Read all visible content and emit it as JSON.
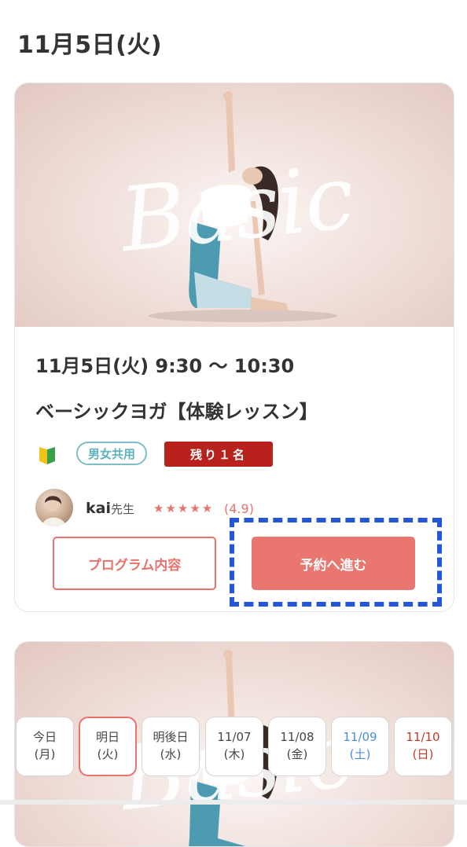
{
  "header": {
    "date": "11月5日(火)"
  },
  "lesson": {
    "hero_text": "Basic",
    "time": "11月5日(火) 9:30 〜 10:30",
    "title": "ベーシックヨガ【体験レッスン】",
    "gender_badge": "男女共用",
    "remaining": "残り１名",
    "teacher_name": "kai",
    "teacher_suffix": "先生",
    "stars": "★★★★★",
    "rating": "(4.9)",
    "rating_value": 4.9,
    "program_button": "プログラム内容",
    "reserve_button": "予約へ進む"
  },
  "second_card": {
    "hero_text": "Basic"
  },
  "day_tabs": [
    {
      "line1": "今日",
      "line2": "(月)"
    },
    {
      "line1": "明日",
      "line2": "(火)"
    },
    {
      "line1": "明後日",
      "line2": "(水)"
    },
    {
      "line1": "11/07",
      "line2": "(木)"
    },
    {
      "line1": "11/08",
      "line2": "(金)"
    },
    {
      "line1": "11/09",
      "line2": "(土)"
    },
    {
      "line1": "11/10",
      "line2": "(日)"
    }
  ],
  "colors": {
    "accent": "#e8726c",
    "remaining_bg": "#b9221c",
    "gender_border": "#7cbfc6",
    "saturday": "#4a90d9",
    "sunday": "#c0392b",
    "highlight": "#2456d6"
  },
  "icons": {
    "beginner": "beginner-mark-icon",
    "star": "star-icon"
  }
}
